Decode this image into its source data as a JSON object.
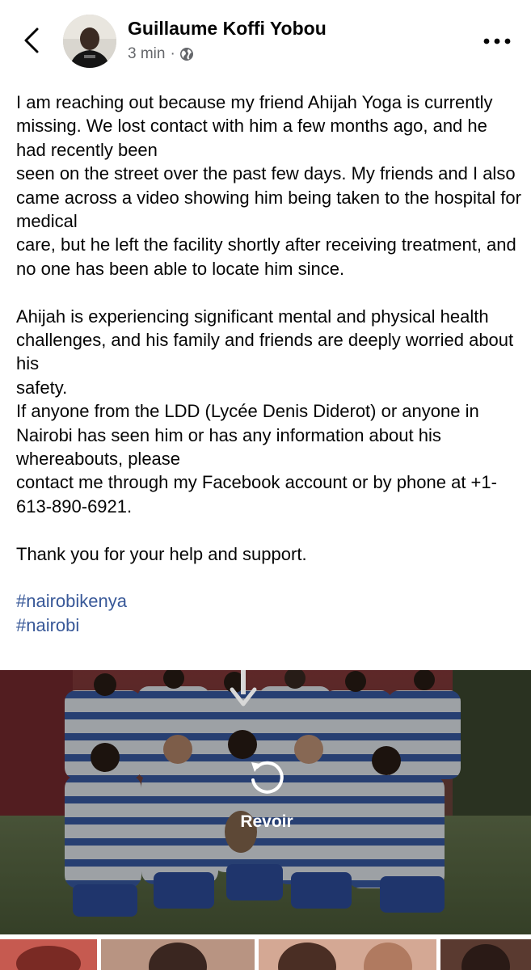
{
  "header": {
    "author_name": "Guillaume Koffi Yobou",
    "timestamp": "3 min",
    "separator": "·",
    "back_icon": "chevron-left-icon",
    "privacy_icon": "globe-icon",
    "more_icon": "more-horizontal-icon"
  },
  "post": {
    "paragraph1": "I am reaching out because my friend Ahijah Yoga is currently missing. We lost contact with him a few months ago, and he had recently been",
    "paragraph1b": "seen on the street over the past few days. My friends and I also came across a video showing him being taken to the hospital for medical",
    "paragraph1c": "care, but he left the facility shortly after receiving treatment, and no one has been able to locate him since.",
    "paragraph2": "Ahijah is experiencing significant mental and physical health challenges, and his family and friends are deeply worried about his",
    "paragraph2b": "safety.",
    "paragraph3": "If anyone from the LDD (Lycée Denis Diderot) or anyone in Nairobi has seen him or has any information about his whereabouts, please",
    "paragraph3b": "contact me through my Facebook account or by phone at +1-613-890-6921.",
    "thanks": "Thank you for your help and support.",
    "hashtags": [
      "#nairobikenya",
      "#nairobi"
    ]
  },
  "media": {
    "replay_label": "Revoir",
    "replay_icon": "replay-icon",
    "download_icon": "down-arrow-icon"
  },
  "colors": {
    "link": "#385898",
    "meta": "#65676b"
  }
}
